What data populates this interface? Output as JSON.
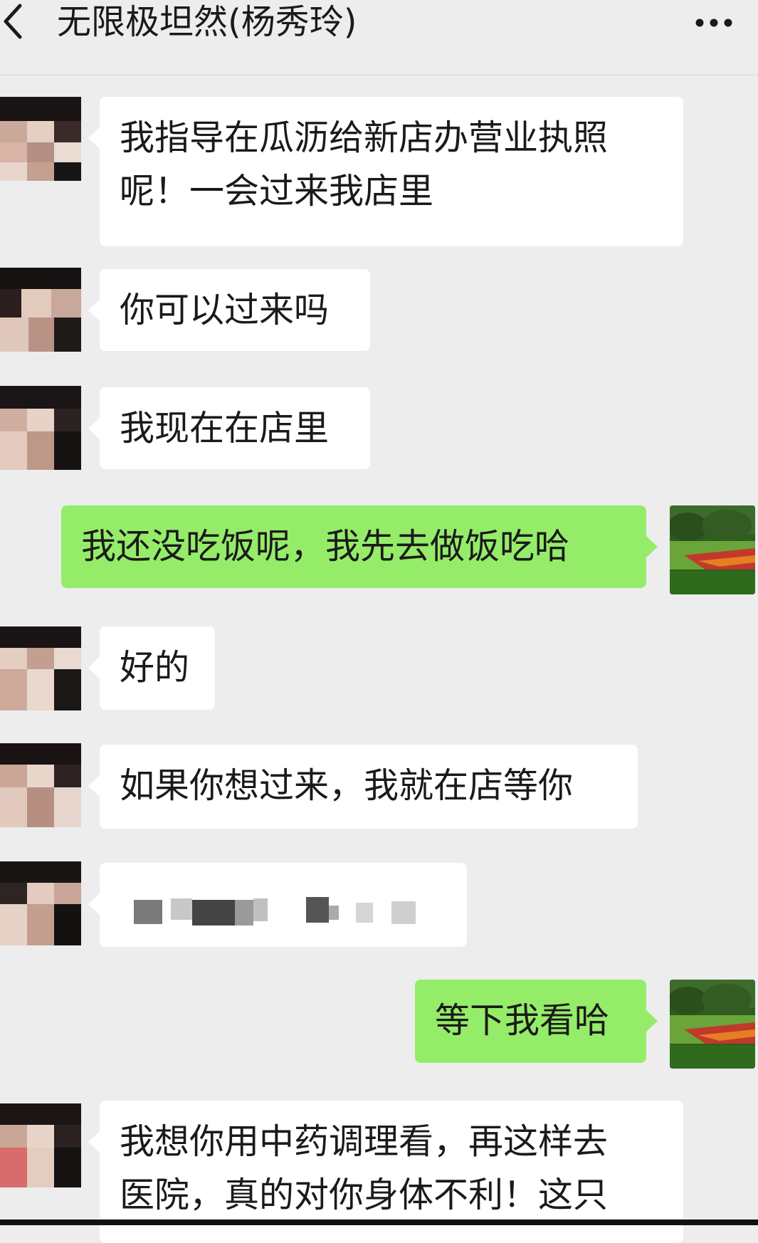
{
  "header": {
    "title": "无限极坦然(杨秀玲)",
    "back_icon": "chevron-left-icon",
    "more_icon": "more-dots-icon"
  },
  "messages": [
    {
      "side": "left",
      "text_lines": [
        "我指导在瓜沥给新店办营业执照",
        "呢！一会过来我店里"
      ]
    },
    {
      "side": "left",
      "text": "你可以过来吗"
    },
    {
      "side": "left",
      "text": "我现在在店里"
    },
    {
      "side": "right",
      "text": "我还没吃饭呢，我先去做饭吃哈"
    },
    {
      "side": "left",
      "text": "好的"
    },
    {
      "side": "left",
      "text": "如果你想过来，我就在店等你"
    },
    {
      "side": "left",
      "pixelated": true
    },
    {
      "side": "right",
      "text": "等下我看哈"
    },
    {
      "side": "left",
      "text_lines": [
        "我想你用中药调理看，再这样去",
        "医院，真的对你身体不利！这只"
      ]
    }
  ],
  "colors": {
    "background": "#ededed",
    "incoming_bubble": "#ffffff",
    "outgoing_bubble": "#95ec69"
  }
}
